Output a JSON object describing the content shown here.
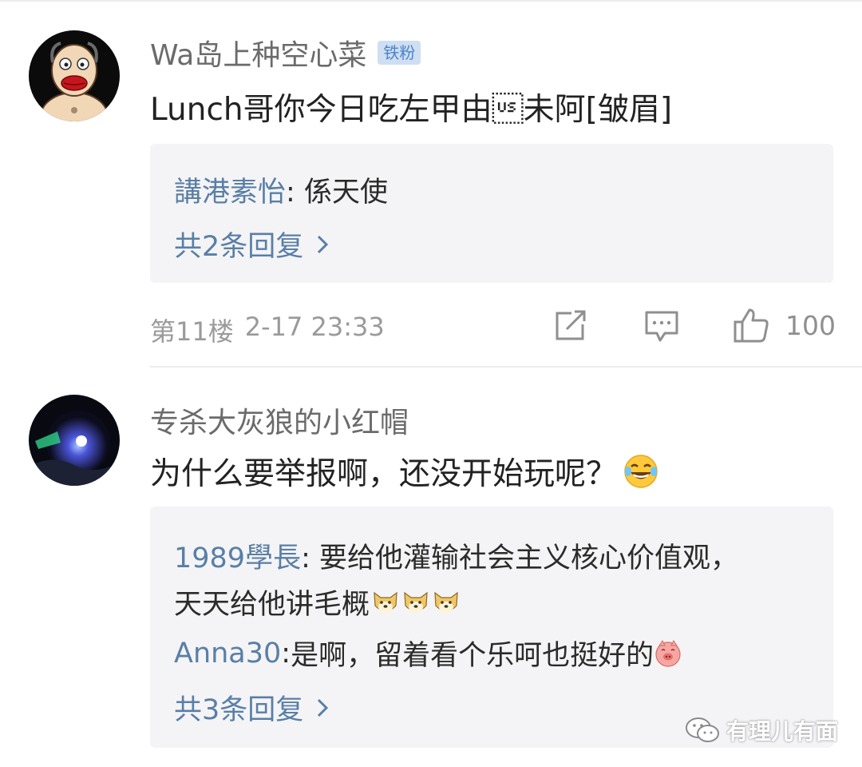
{
  "comments": [
    {
      "username": "Wa岛上种空心菜",
      "badge": "铁粉",
      "text": "Lunch哥你今日吃左甲由\u001f未阿[皱眉]",
      "replies": [
        {
          "name": "講港素怡",
          "sep": ": ",
          "text": "係天使"
        }
      ],
      "more_replies": "共2条回复",
      "floor": "第11楼",
      "time": "2-17 23:33",
      "likes": "100"
    },
    {
      "username": "专杀大灰狼的小红帽",
      "text": "为什么要举报啊，还没开始玩呢？",
      "replies": [
        {
          "name": "1989學長",
          "sep": ": ",
          "text": "要给他灌输社会主义核心价值观，",
          "text2": "天天给他讲毛概"
        },
        {
          "name": "Anna30",
          "sep": ": ",
          "text": "是啊，留着看个乐呵也挺好的"
        }
      ],
      "more_replies": "共3条回复"
    }
  ],
  "icons": {
    "share": "share-icon",
    "comment": "comment-icon",
    "like": "thumbs-up-icon",
    "laugh": "laugh-cry-emoji",
    "doge": "doge-emoji",
    "pig": "pig-emoji",
    "wechat": "wechat-icon"
  },
  "watermark": "有理儿有面",
  "colors": {
    "link": "#5a7fa6",
    "badge_bg": "#cfdef3",
    "badge_text": "#4b84c8",
    "reply_bg": "#f4f4f6"
  }
}
